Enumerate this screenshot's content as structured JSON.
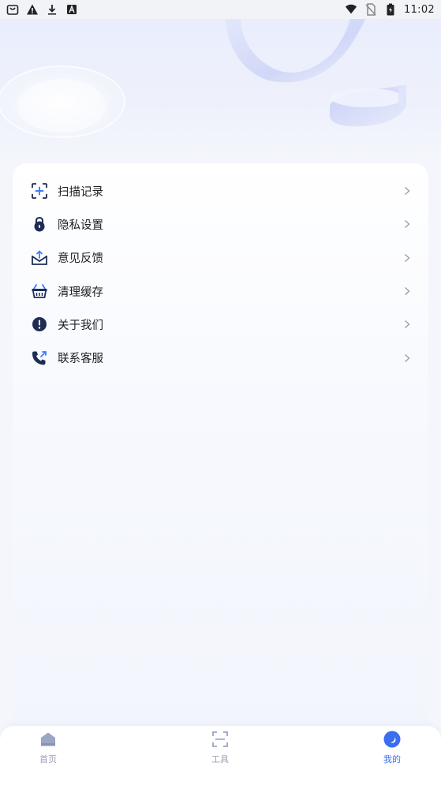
{
  "status_bar": {
    "time": "11:02",
    "left_icons": [
      "shopping-bag-icon",
      "warning-icon",
      "download-icon",
      "a-icon"
    ],
    "right_icons": [
      "wifi-icon",
      "no-sim-icon",
      "battery-icon"
    ]
  },
  "menu": {
    "items": [
      {
        "label": "扫描记录",
        "icon": "scan-add-icon"
      },
      {
        "label": "隐私设置",
        "icon": "lock-icon"
      },
      {
        "label": "意见反馈",
        "icon": "mail-upload-icon"
      },
      {
        "label": "清理缓存",
        "icon": "basket-icon"
      },
      {
        "label": "关于我们",
        "icon": "info-alert-icon"
      },
      {
        "label": "联系客服",
        "icon": "phone-call-icon"
      }
    ]
  },
  "bottom_nav": {
    "items": [
      {
        "label": "首页",
        "icon": "home-icon",
        "active": false
      },
      {
        "label": "工具",
        "icon": "scan-frame-icon",
        "active": false
      },
      {
        "label": "我的",
        "icon": "profile-moon-icon",
        "active": true
      }
    ]
  },
  "colors": {
    "accent": "#3a6df0",
    "icon_dark": "#1f2d54",
    "icon_accent": "#3f7df5",
    "nav_inactive": "#9aa1b3"
  }
}
